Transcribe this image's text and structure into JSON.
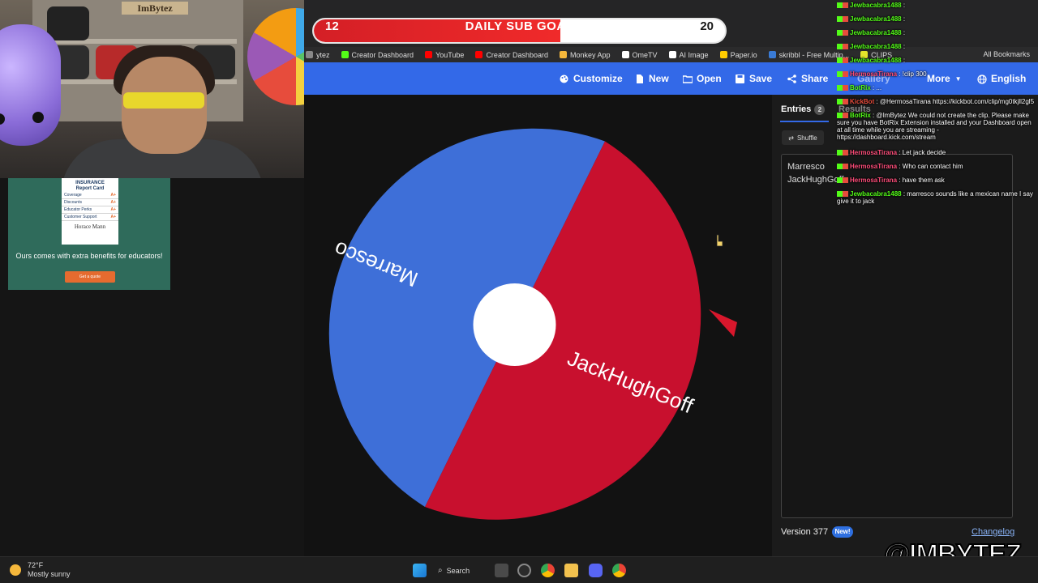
{
  "webcam": {
    "sign_text": "ImBytez"
  },
  "ad": {
    "card_title": "INSURANCE\nReport Card",
    "card_rows": [
      {
        "label": "Coverage",
        "grade": "A+"
      },
      {
        "label": "Discounts",
        "grade": "A+"
      },
      {
        "label": "Educator Perks",
        "grade": "A+"
      },
      {
        "label": "Customer Support",
        "grade": "A+"
      }
    ],
    "brand": "Horace Mann",
    "headline": "Ours comes with extra benefits for educators!",
    "cta": "Get a quote"
  },
  "sub_goal": {
    "current": "12",
    "label": "DAILY SUB GOAL",
    "target": "20",
    "progress": 0.6
  },
  "bookmarks": [
    {
      "label": "ytez",
      "color": "#888888"
    },
    {
      "label": "Creator Dashboard",
      "color": "#53fc18"
    },
    {
      "label": "YouTube",
      "color": "#ff0000"
    },
    {
      "label": "Creator Dashboard",
      "color": "#ff0000"
    },
    {
      "label": "Monkey App",
      "color": "#f5b73b"
    },
    {
      "label": "OmeTV",
      "color": "#ffffff"
    },
    {
      "label": "AI Image",
      "color": "#ffffff"
    },
    {
      "label": "Paper.io",
      "color": "#ffcc00"
    },
    {
      "label": "skribbl - Free Multip...",
      "color": "#3a7bd5"
    },
    {
      "label": "CLIPS",
      "color": "#e5e52b"
    }
  ],
  "all_bookmarks": "All Bookmarks",
  "toolbar": {
    "customize": "Customize",
    "new": "New",
    "open": "Open",
    "save": "Save",
    "share": "Share",
    "gallery": "Gallery",
    "more": "More",
    "language": "English"
  },
  "wheel": {
    "segments": [
      {
        "label": "Marresco",
        "color": "#3e6fd8"
      },
      {
        "label": "JackHughGoff",
        "color": "#c8102e"
      }
    ],
    "pointer_color": "#d8172c"
  },
  "panel": {
    "tab_entries": "Entries",
    "entries_count": "2",
    "tab_results": "Results",
    "shuffle": "Shuffle",
    "entries": [
      "Marresco",
      "JackHughGoff"
    ],
    "version": "Version 377",
    "new_badge": "New!",
    "changelog": "Changelog"
  },
  "chat": [
    {
      "user": "Jewbacabra1488",
      "text": ":",
      "color": "#53fc18"
    },
    {
      "user": "Jewbacabra1488",
      "text": ":",
      "color": "#53fc18"
    },
    {
      "user": "Jewbacabra1488",
      "text": ":",
      "color": "#53fc18"
    },
    {
      "user": "Jewbacabra1488",
      "text": ":",
      "color": "#53fc18"
    },
    {
      "user": "Jewbacabra1488",
      "text": ":",
      "color": "#53fc18"
    },
    {
      "user": "HermosaTirana",
      "text": ": !clip 300",
      "color": "#ff4d7a"
    },
    {
      "user": "BotRix",
      "text": ": ...",
      "color": "#53fc18"
    },
    {
      "user": "KickBot",
      "text": ": @HermosaTirana https://kickbot.com/clip/mg0tkjll2gl5",
      "color": "#e74c3c"
    },
    {
      "user": "BotRix",
      "text": ": @ImBytez We could not create the clip. Please make sure you have BotRix Extension installed and your Dashboard open at all time while you are streaming - https://dashboard.kick.com/stream",
      "color": "#53fc18"
    },
    {
      "user": "HermosaTirana",
      "text": ": Let jack decide",
      "color": "#ff4d7a"
    },
    {
      "user": "HermosaTirana",
      "text": ": Who can contact him",
      "color": "#ff4d7a"
    },
    {
      "user": "HermosaTirana",
      "text": ": have them ask",
      "color": "#ff4d7a"
    },
    {
      "user": "Jewbacabra1488",
      "text": ": marresco sounds like a mexican name I say give it to jack",
      "color": "#53fc18"
    }
  ],
  "watermark": "@IMBYTEZ",
  "taskbar": {
    "temperature": "72°F",
    "condition": "Mostly sunny",
    "search": "Search"
  }
}
